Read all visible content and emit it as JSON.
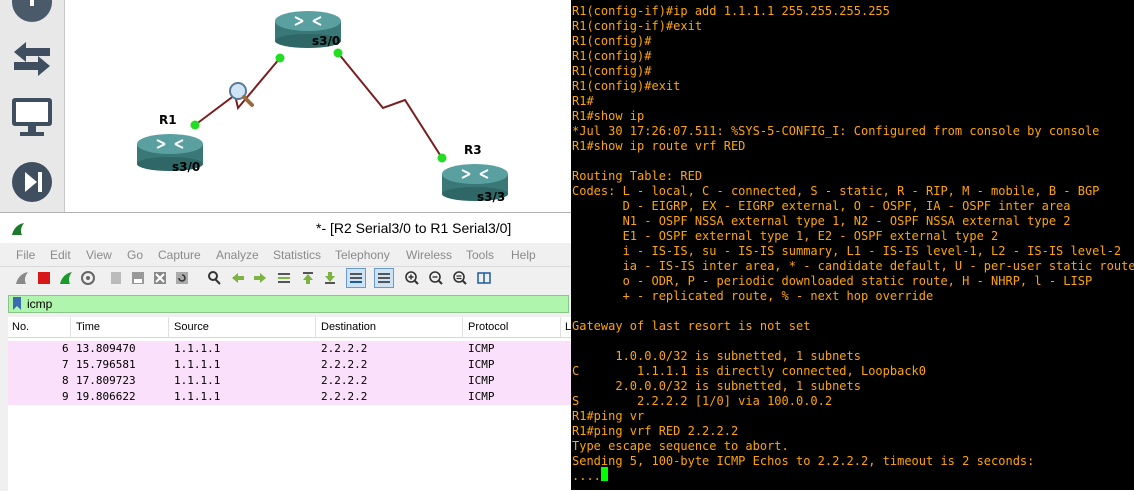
{
  "rail": {
    "icons": [
      "move-icon",
      "swap-icon",
      "monitor-icon",
      "next-icon"
    ]
  },
  "topology": {
    "routers": [
      {
        "name": "",
        "port": "s3/0"
      },
      {
        "name": "R1",
        "port": "s3/0"
      },
      {
        "name": "R3",
        "port": "s3/3"
      }
    ]
  },
  "wireshark": {
    "title": "*- [R2 Serial3/0 to R1 Serial3/0]",
    "menu": [
      "File",
      "Edit",
      "View",
      "Go",
      "Capture",
      "Analyze",
      "Statistics",
      "Telephony",
      "Wireless",
      "Tools",
      "Help"
    ],
    "filter": "icmp",
    "columns": [
      "No.",
      "Time",
      "Source",
      "Destination",
      "Protocol",
      "L"
    ],
    "packets": [
      {
        "no": "6",
        "time": "13.809470",
        "source": "1.1.1.1",
        "destination": "2.2.2.2",
        "protocol": "ICMP"
      },
      {
        "no": "7",
        "time": "15.796581",
        "source": "1.1.1.1",
        "destination": "2.2.2.2",
        "protocol": "ICMP"
      },
      {
        "no": "8",
        "time": "17.809723",
        "source": "1.1.1.1",
        "destination": "2.2.2.2",
        "protocol": "ICMP"
      },
      {
        "no": "9",
        "time": "19.806622",
        "source": "1.1.1.1",
        "destination": "2.2.2.2",
        "protocol": "ICMP"
      }
    ]
  },
  "terminal": {
    "lines": [
      "R1(config-if)#ip add 1.1.1.1 255.255.255.255",
      "R1(config-if)#exit",
      "R1(config)#",
      "R1(config)#",
      "R1(config)#",
      "R1(config)#exit",
      "R1#",
      "R1#show ip",
      "*Jul 30 17:26:07.511: %SYS-5-CONFIG_I: Configured from console by console",
      "R1#show ip route vrf RED",
      "",
      "Routing Table: RED",
      "Codes: L - local, C - connected, S - static, R - RIP, M - mobile, B - BGP",
      "       D - EIGRP, EX - EIGRP external, O - OSPF, IA - OSPF inter area",
      "       N1 - OSPF NSSA external type 1, N2 - OSPF NSSA external type 2",
      "       E1 - OSPF external type 1, E2 - OSPF external type 2",
      "       i - IS-IS, su - IS-IS summary, L1 - IS-IS level-1, L2 - IS-IS level-2",
      "       ia - IS-IS inter area, * - candidate default, U - per-user static route",
      "       o - ODR, P - periodic downloaded static route, H - NHRP, l - LISP",
      "       + - replicated route, % - next hop override",
      "",
      "Gateway of last resort is not set",
      "",
      "      1.0.0.0/32 is subnetted, 1 subnets",
      "C        1.1.1.1 is directly connected, Loopback0",
      "      2.0.0.0/32 is subnetted, 1 subnets",
      "S        2.2.2.2 [1/0] via 100.0.0.2",
      "R1#ping vr",
      "R1#ping vrf RED 2.2.2.2",
      "Type escape sequence to abort.",
      "Sending 5, 100-byte ICMP Echos to 2.2.2.2, timeout is 2 seconds:",
      "...."
    ]
  },
  "colors": {
    "terminal_text": "#ffa500",
    "terminal_bg": "#000000",
    "cursor": "#00ff00",
    "packet_row": "#fae0fa",
    "filter_bg": "#aff5ad",
    "link": "#7a1f1f",
    "port_dot": "#22dd22",
    "router_body": "#4f8f8f"
  }
}
